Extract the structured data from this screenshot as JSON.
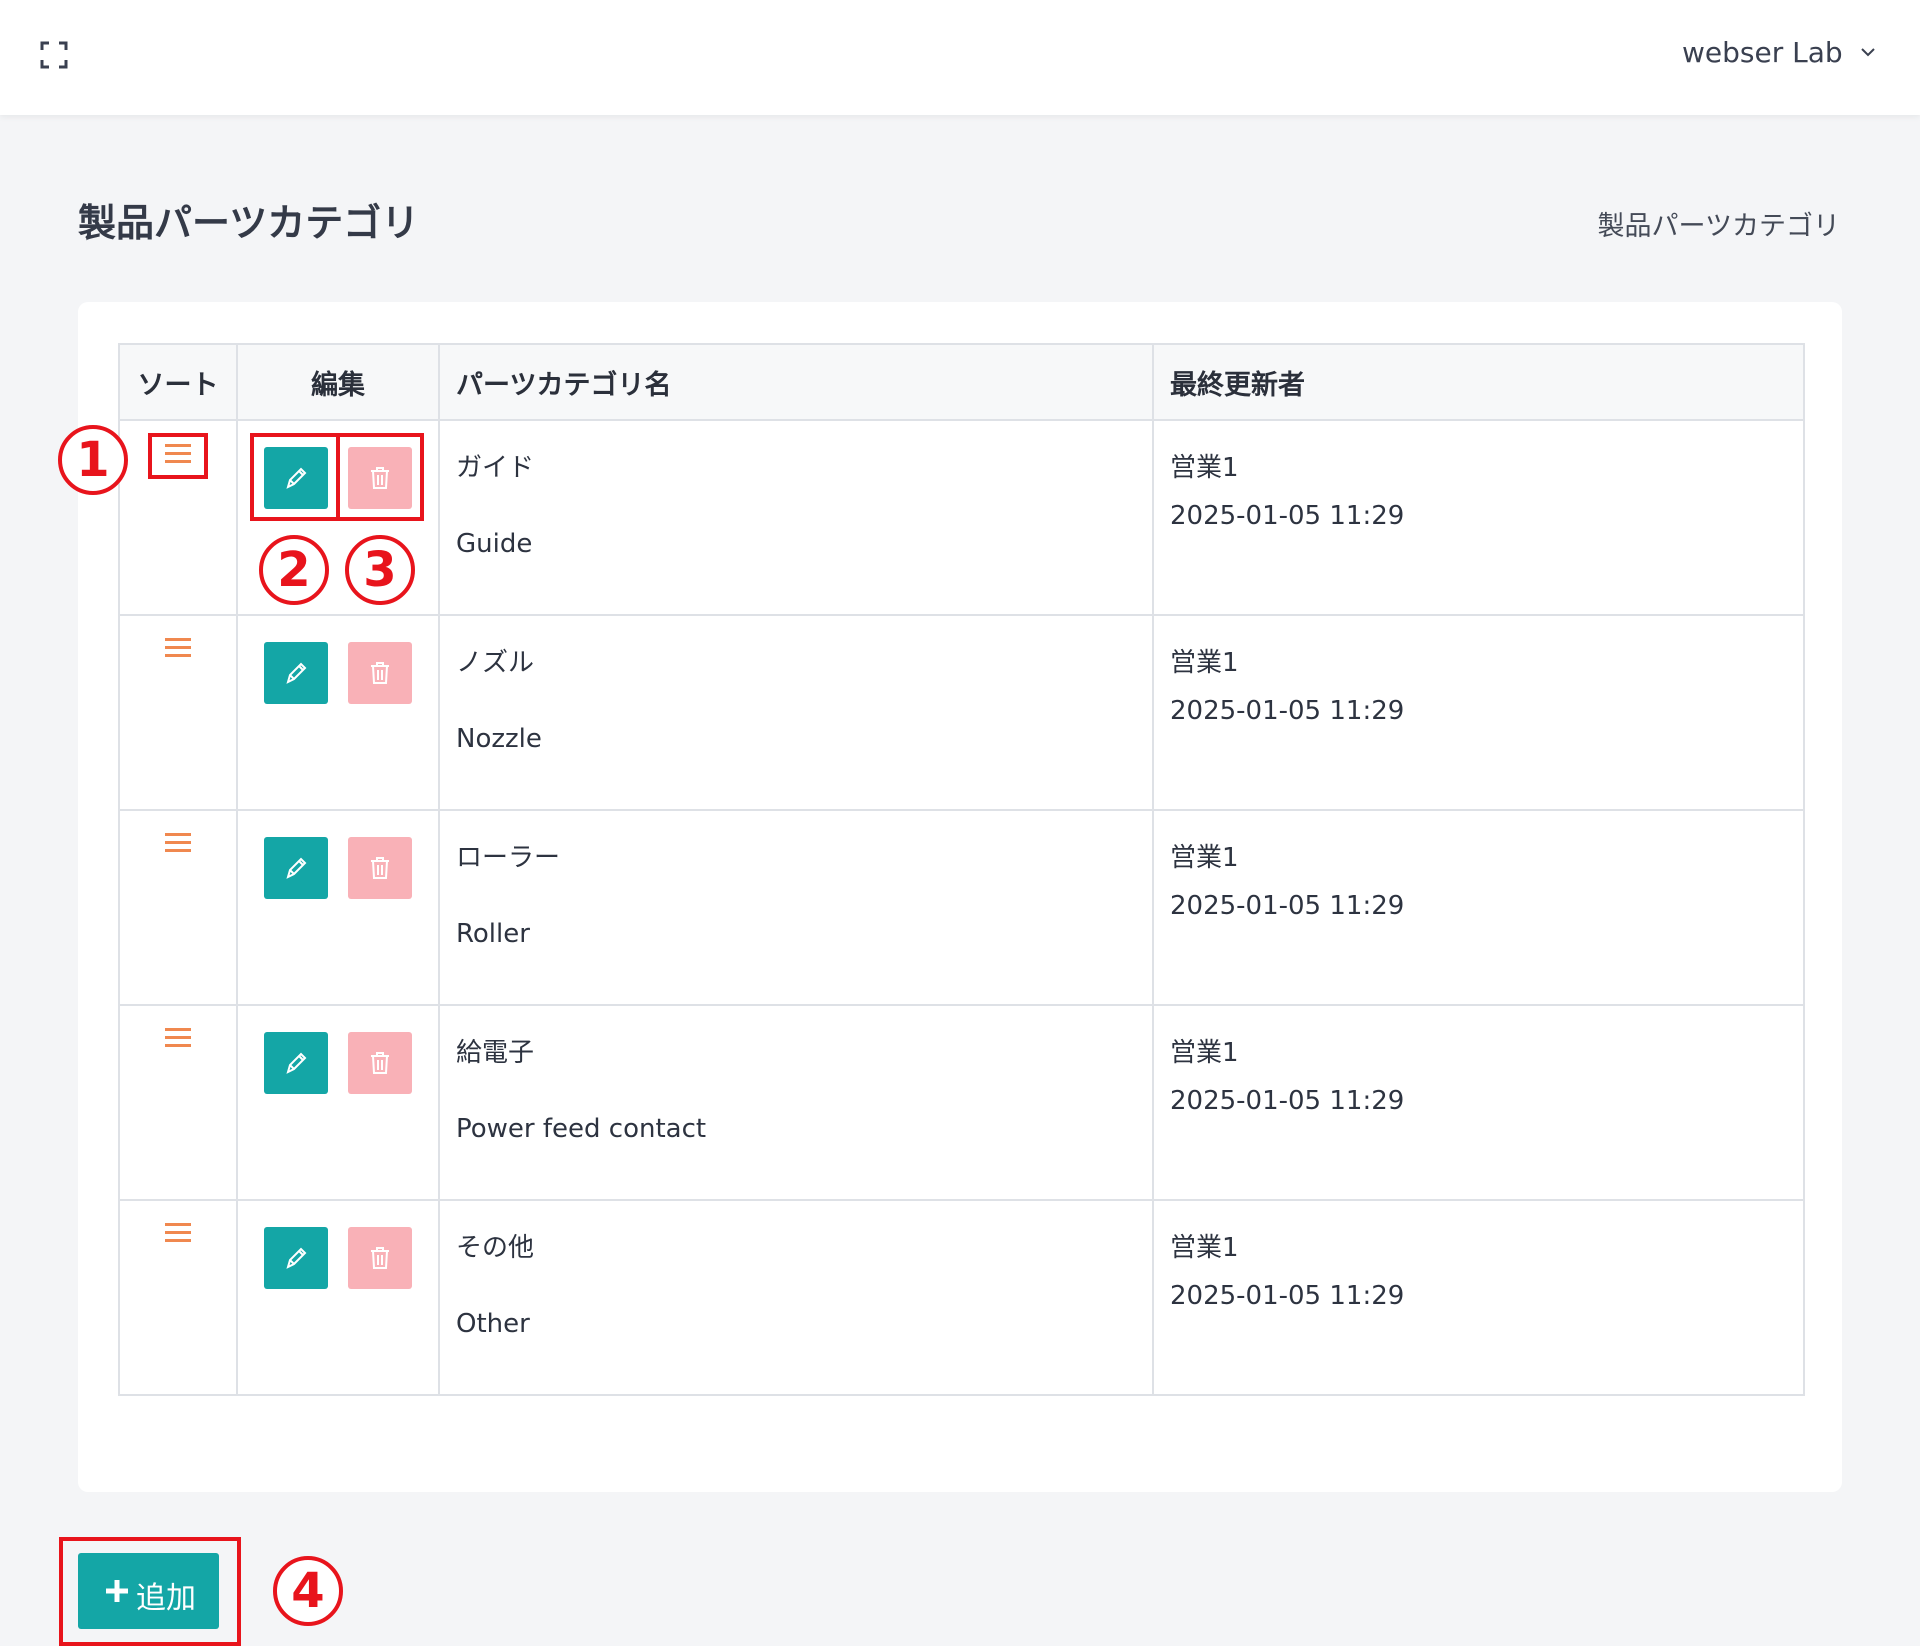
{
  "header": {
    "user_name": "webser Lab"
  },
  "page": {
    "title": "製品パーツカテゴリ",
    "breadcrumb": "製品パーツカテゴリ"
  },
  "table": {
    "columns": {
      "sort": "ソート",
      "edit": "編集",
      "name": "パーツカテゴリ名",
      "updated_by": "最終更新者"
    },
    "rows": [
      {
        "name_ja": "ガイド",
        "name_en": "Guide",
        "updated_by": "営業1",
        "updated_at": "2025-01-05 11:29"
      },
      {
        "name_ja": "ノズル",
        "name_en": "Nozzle",
        "updated_by": "営業1",
        "updated_at": "2025-01-05 11:29"
      },
      {
        "name_ja": "ローラー",
        "name_en": "Roller",
        "updated_by": "営業1",
        "updated_at": "2025-01-05 11:29"
      },
      {
        "name_ja": "給電子",
        "name_en": "Power feed contact",
        "updated_by": "営業1",
        "updated_at": "2025-01-05 11:29"
      },
      {
        "name_ja": "その他",
        "name_en": "Other",
        "updated_by": "営業1",
        "updated_at": "2025-01-05 11:29"
      }
    ]
  },
  "add_button": {
    "label": "追加"
  },
  "annotations": [
    "1",
    "2",
    "3",
    "4"
  ],
  "colors": {
    "accent_teal": "#14a6a6",
    "delete_pink": "#f9b1b7",
    "sort_orange": "#f0884f",
    "highlight_red": "#e8141c"
  },
  "icons": [
    "expand-icon",
    "chevron-down-icon",
    "drag-handle-icon",
    "pencil-icon",
    "trash-icon",
    "plus-icon"
  ]
}
